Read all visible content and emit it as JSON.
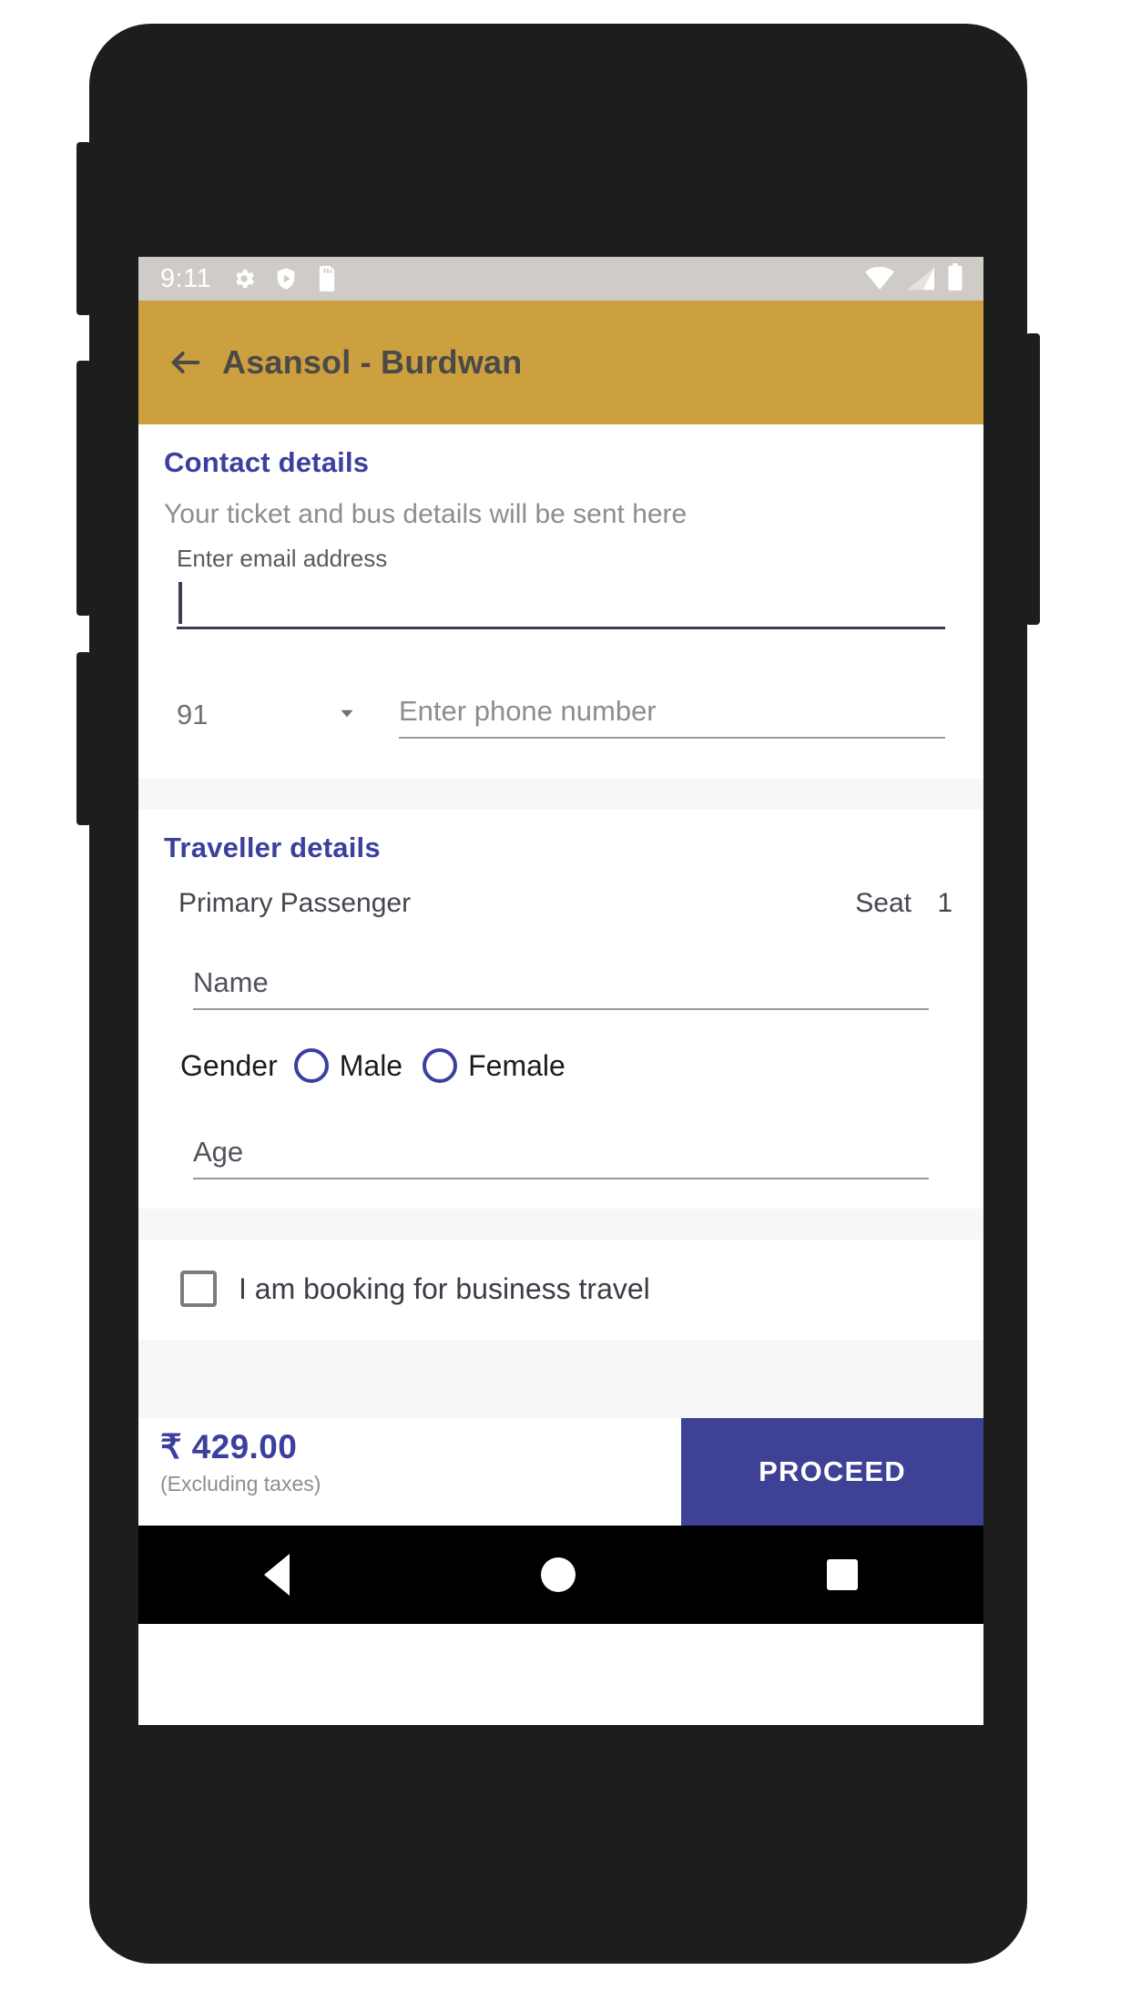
{
  "status_bar": {
    "time": "9:11",
    "left_icons": [
      "gear-icon",
      "play-shield-icon",
      "sd-card-icon"
    ],
    "right_icons": [
      "wifi-icon",
      "cellular-signal-icon",
      "battery-icon"
    ]
  },
  "app_bar": {
    "back_icon": "back-arrow-icon",
    "title": "Asansol - Burdwan",
    "background_color": "#cc9f3f",
    "title_color": "#4a4a48"
  },
  "contact": {
    "title": "Contact details",
    "subtitle": "Your ticket and bus details will be sent here",
    "email_label": "Enter email address",
    "email_value": "",
    "email_focused": true,
    "country_code": "91",
    "country_code_icon": "chevron-down-icon",
    "phone_placeholder": "Enter phone number",
    "phone_value": ""
  },
  "traveller": {
    "title": "Traveller details",
    "passenger_label": "Primary Passenger",
    "seat_label": "Seat",
    "seat_number": "1",
    "name_placeholder": "Name",
    "name_value": "",
    "gender_label": "Gender",
    "gender_options": [
      {
        "label": "Male",
        "selected": false
      },
      {
        "label": "Female",
        "selected": false
      }
    ],
    "age_placeholder": "Age",
    "age_value": ""
  },
  "business": {
    "label": "I am booking for business travel",
    "checked": false
  },
  "bottom_bar": {
    "price": "₹ 429.00",
    "price_note": "(Excluding taxes)",
    "proceed_label": "PROCEED",
    "proceed_color": "#3f4196",
    "price_color": "#3b3f9e"
  },
  "nav_bar": {
    "back_icon": "nav-back-icon",
    "home_icon": "nav-home-icon",
    "recents_icon": "nav-recents-icon"
  },
  "theme": {
    "accent": "#3b3f9e",
    "app_bar": "#cc9f3f"
  }
}
